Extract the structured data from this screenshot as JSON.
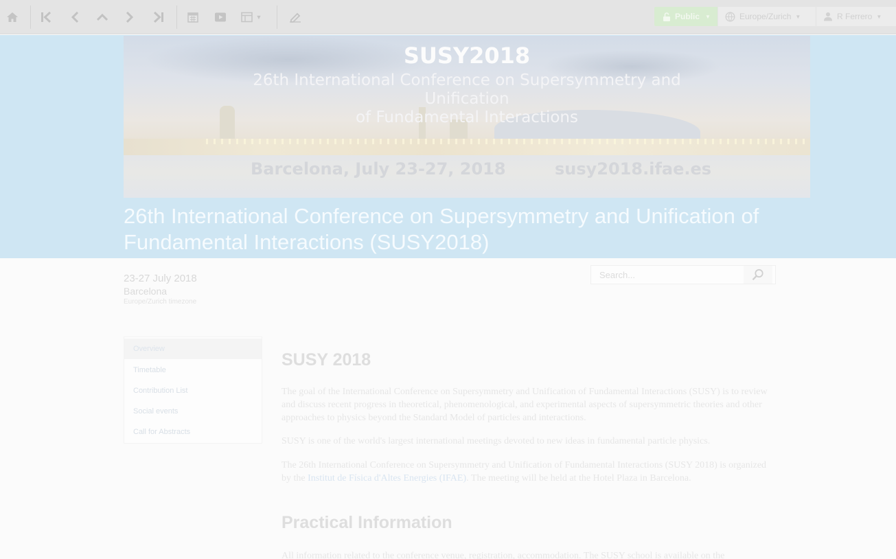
{
  "toolbar": {
    "buttons": [
      {
        "icon": "home-icon"
      },
      {
        "icon": "first-page-icon"
      },
      {
        "icon": "previous-icon"
      },
      {
        "icon": "up-icon"
      },
      {
        "icon": "next-icon"
      },
      {
        "icon": "last-page-icon"
      },
      {
        "icon": "calendar-icon"
      },
      {
        "icon": "video-icon"
      },
      {
        "icon": "layout-icon"
      },
      {
        "icon": "edit-icon"
      }
    ],
    "protection_label": "Public",
    "timezone_label": "Europe/Zurich",
    "user_label": "R Ferrero"
  },
  "banner": {
    "title": "SUSY2018",
    "subtitle_line1": "26th International Conference on Supersymmetry and Unification",
    "subtitle_line2": "of Fundamental Interactions",
    "location_date": "Barcelona, July 23-27, 2018",
    "url": "susy2018.ifae.es"
  },
  "event": {
    "title": "26th International Conference on Supersymmetry and Unification of Fundamental Interactions (SUSY2018)",
    "date": "23-27 July 2018",
    "place": "Barcelona",
    "timezone": "Europe/Zurich timezone"
  },
  "search": {
    "placeholder": "Search..."
  },
  "menu": {
    "items": [
      {
        "label": "Overview",
        "active": true
      },
      {
        "label": "Timetable",
        "active": false
      },
      {
        "label": "Contribution List",
        "active": false
      },
      {
        "label": "Social events",
        "active": false
      },
      {
        "label": "Call for Abstracts",
        "active": false
      }
    ]
  },
  "content": {
    "heading": "SUSY 2018",
    "para1": "The goal of the International Conference on Supersymmetry and Unification of Fundamental Interactions (SUSY) is to review and discuss recent progress in theoretical, phenomenological, and experimental aspects of supersymmetric theories and other approaches to physics beyond the Standard Model of particles and interactions.",
    "para2": "SUSY is one of the world's largest international meetings devoted to new ideas in fundamental particle physics.",
    "para3_start": "The 26th International Conference on Supersymmetry and Unification of Fundamental Interactions (SUSY 2018) is organized by the ",
    "para3_link": "Institut de Física d'Altes Energies (IFAE)",
    "para3_end": ". The meeting will be held at the Hotel Plaza in Barcelona.",
    "heading2": "Practical Information",
    "para4": "All information related to the conference venue, registration, accommodation. The SUSY school is available on the"
  }
}
